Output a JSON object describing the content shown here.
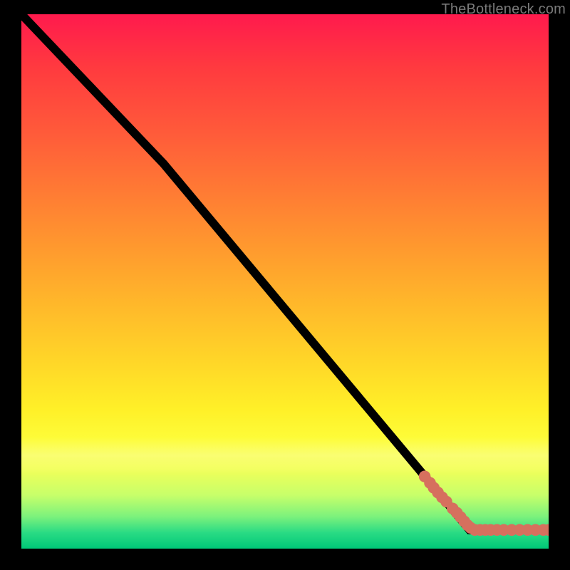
{
  "attribution_text": "TheBottleneck.com",
  "chart_data": {
    "type": "line",
    "title": "",
    "xlabel": "",
    "ylabel": "",
    "xlim": [
      0,
      100
    ],
    "ylim": [
      0,
      100
    ],
    "curve": [
      {
        "x": 0,
        "y": 100
      },
      {
        "x": 27,
        "y": 72
      },
      {
        "x": 85,
        "y": 3.5
      },
      {
        "x": 100,
        "y": 3.5
      }
    ],
    "series": [
      {
        "name": "points",
        "color": "#d6705e",
        "marker_radius_px": 4,
        "points": [
          {
            "x": 76.5,
            "y": 13.5
          },
          {
            "x": 77.5,
            "y": 12.3
          },
          {
            "x": 78.2,
            "y": 11.4
          },
          {
            "x": 79.0,
            "y": 10.5
          },
          {
            "x": 79.8,
            "y": 9.6
          },
          {
            "x": 80.6,
            "y": 8.8
          },
          {
            "x": 81.8,
            "y": 7.5
          },
          {
            "x": 82.6,
            "y": 6.7
          },
          {
            "x": 83.3,
            "y": 5.9
          },
          {
            "x": 84.0,
            "y": 5.1
          },
          {
            "x": 84.6,
            "y": 4.4
          },
          {
            "x": 85.2,
            "y": 3.9
          },
          {
            "x": 86.0,
            "y": 3.5
          },
          {
            "x": 87.0,
            "y": 3.5
          },
          {
            "x": 88.0,
            "y": 3.5
          },
          {
            "x": 89.0,
            "y": 3.5
          },
          {
            "x": 90.2,
            "y": 3.5
          },
          {
            "x": 91.5,
            "y": 3.5
          },
          {
            "x": 93.0,
            "y": 3.5
          },
          {
            "x": 94.5,
            "y": 3.5
          },
          {
            "x": 96.0,
            "y": 3.5
          },
          {
            "x": 97.5,
            "y": 3.5
          },
          {
            "x": 99.0,
            "y": 3.5
          },
          {
            "x": 100.0,
            "y": 3.5
          }
        ]
      }
    ]
  }
}
